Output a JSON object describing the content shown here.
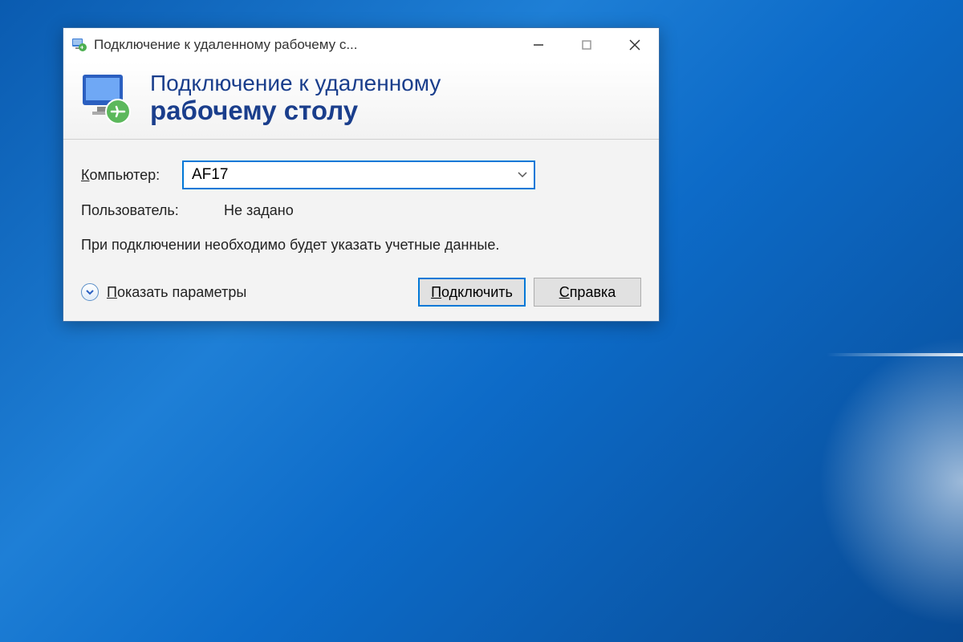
{
  "window": {
    "title": "Подключение к удаленному рабочему с..."
  },
  "banner": {
    "line1": "Подключение к удаленному",
    "line2": "рабочему столу"
  },
  "form": {
    "computer_label_pre": "К",
    "computer_label_rest": "омпьютер:",
    "computer_value": "AF17",
    "user_label": "Пользователь:",
    "user_value": "Не задано",
    "info_text": "При подключении необходимо будет указать учетные данные."
  },
  "footer": {
    "show_params_pre": "П",
    "show_params_rest": "оказать параметры",
    "connect_pre": "П",
    "connect_rest": "одключить",
    "help_pre": "С",
    "help_rest": "правка"
  }
}
